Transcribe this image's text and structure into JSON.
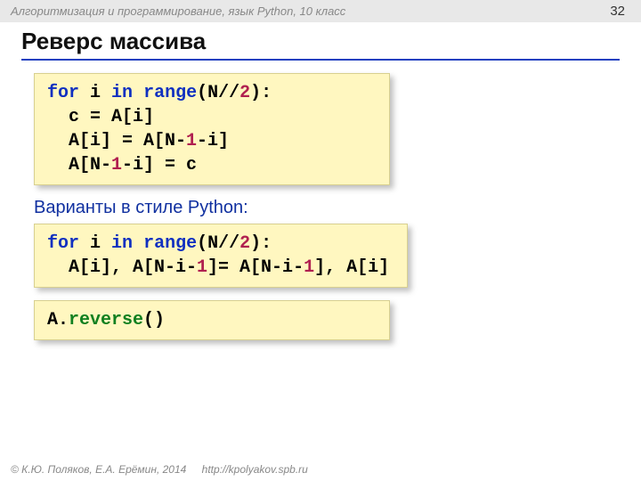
{
  "header": {
    "course": "Алгоритмизация и программирование, язык Python, 10 класс",
    "page": "32"
  },
  "title": "Реверс массива",
  "code1": {
    "l1_for": "for",
    "l1_in": "in",
    "l1_range": "range",
    "l1_open": "i ",
    "l1_after_range": "(N//",
    "l1_two": "2",
    "l1_close": "):",
    "l2": "  c = A[i]",
    "l3a": "  A[i] = A[N-",
    "l3b": "1",
    "l3c": "-i]",
    "l4a": "  A[N-",
    "l4b": "1",
    "l4c": "-i] = c"
  },
  "subtitle": "Варианты в стиле Python:",
  "code2": {
    "l1_for": "for",
    "l1_in": "in",
    "l1_range": "range",
    "l1_open": "i ",
    "l1_after_range": "(N//",
    "l1_two": "2",
    "l1_close": "):",
    "l2a": "  A[i], A[N-i-",
    "l2b": "1",
    "l2c": "]= A[N-i-",
    "l2d": "1",
    "l2e": "], A[i]"
  },
  "code3": {
    "a": "A.",
    "rev": "reverse",
    "par": "()"
  },
  "footer": {
    "copy": "© К.Ю. Поляков, Е.А. Ерёмин, 2014",
    "link": "http://kpolyakov.spb.ru"
  }
}
